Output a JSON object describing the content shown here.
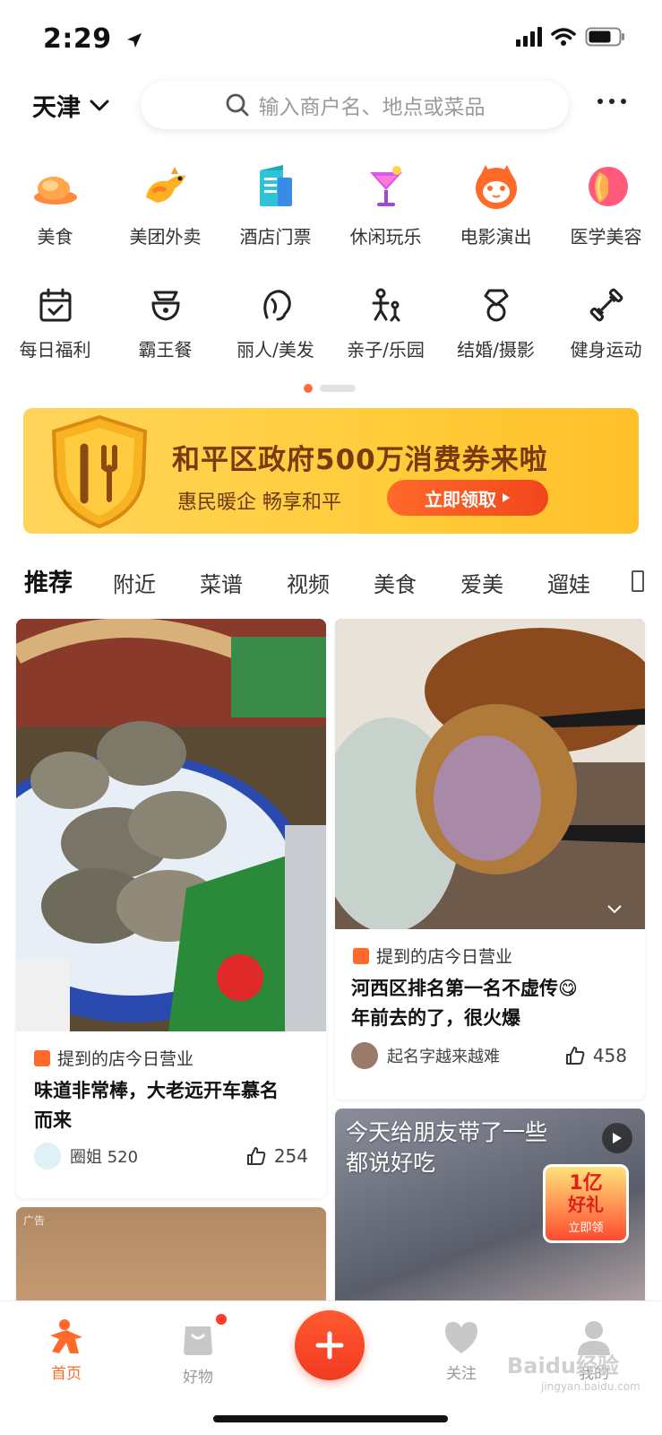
{
  "status_bar": {
    "time": "2:29"
  },
  "header": {
    "city": "天津",
    "search_placeholder": "输入商户名、地点或菜品"
  },
  "categories_row1": [
    {
      "label": "美食",
      "icon": "roast-chicken-icon"
    },
    {
      "label": "美团外卖",
      "icon": "kangaroo-icon"
    },
    {
      "label": "酒店门票",
      "icon": "hotel-building-icon"
    },
    {
      "label": "休闲玩乐",
      "icon": "cocktail-icon"
    },
    {
      "label": "电影演出",
      "icon": "cat-face-icon"
    },
    {
      "label": "医学美容",
      "icon": "face-profile-icon"
    }
  ],
  "categories_row2": [
    {
      "label": "每日福利",
      "icon": "calendar-check-icon"
    },
    {
      "label": "霸王餐",
      "icon": "chef-icon"
    },
    {
      "label": "丽人/美发",
      "icon": "hair-icon"
    },
    {
      "label": "亲子/乐园",
      "icon": "parent-child-icon"
    },
    {
      "label": "结婚/摄影",
      "icon": "diamond-ring-icon"
    },
    {
      "label": "健身运动",
      "icon": "dumbbell-icon"
    }
  ],
  "banner": {
    "title": "和平区政府500万消费券来啦",
    "subtitle": "惠民暖企 畅享和平",
    "button": "立即领取"
  },
  "tabs": [
    "推荐",
    "附近",
    "菜谱",
    "视频",
    "美食",
    "爱美",
    "遛娃"
  ],
  "feed": {
    "left": [
      {
        "shop_tag": "提到的店今日营业",
        "title_line1": "味道非常棒，大老远开车慕名",
        "title_line2": "而来",
        "author": "圈姐 520",
        "likes": "254"
      },
      {
        "ad_label": "广告"
      }
    ],
    "right": [
      {
        "shop_tag": "提到的店今日营业",
        "title_line1": "河西区排名第一名不虚传😋",
        "title_line2": "年前去的了，很火爆",
        "author": "起名字越来越难",
        "likes": "458"
      },
      {
        "overlay_line1": "今天给朋友带了一些",
        "overlay_line2": "都说好吃",
        "promo_line1": "1亿",
        "promo_line2": "好礼",
        "promo_button": "立即领"
      }
    ]
  },
  "bottom_nav": {
    "home": "首页",
    "goods": "好物",
    "follow": "关注",
    "mine": "我的"
  },
  "watermark": {
    "main": "Baidu经验",
    "sub": "jingyan.baidu.com"
  },
  "colors": {
    "accent": "#ff6a2a",
    "banner": "#ffcc3a"
  }
}
